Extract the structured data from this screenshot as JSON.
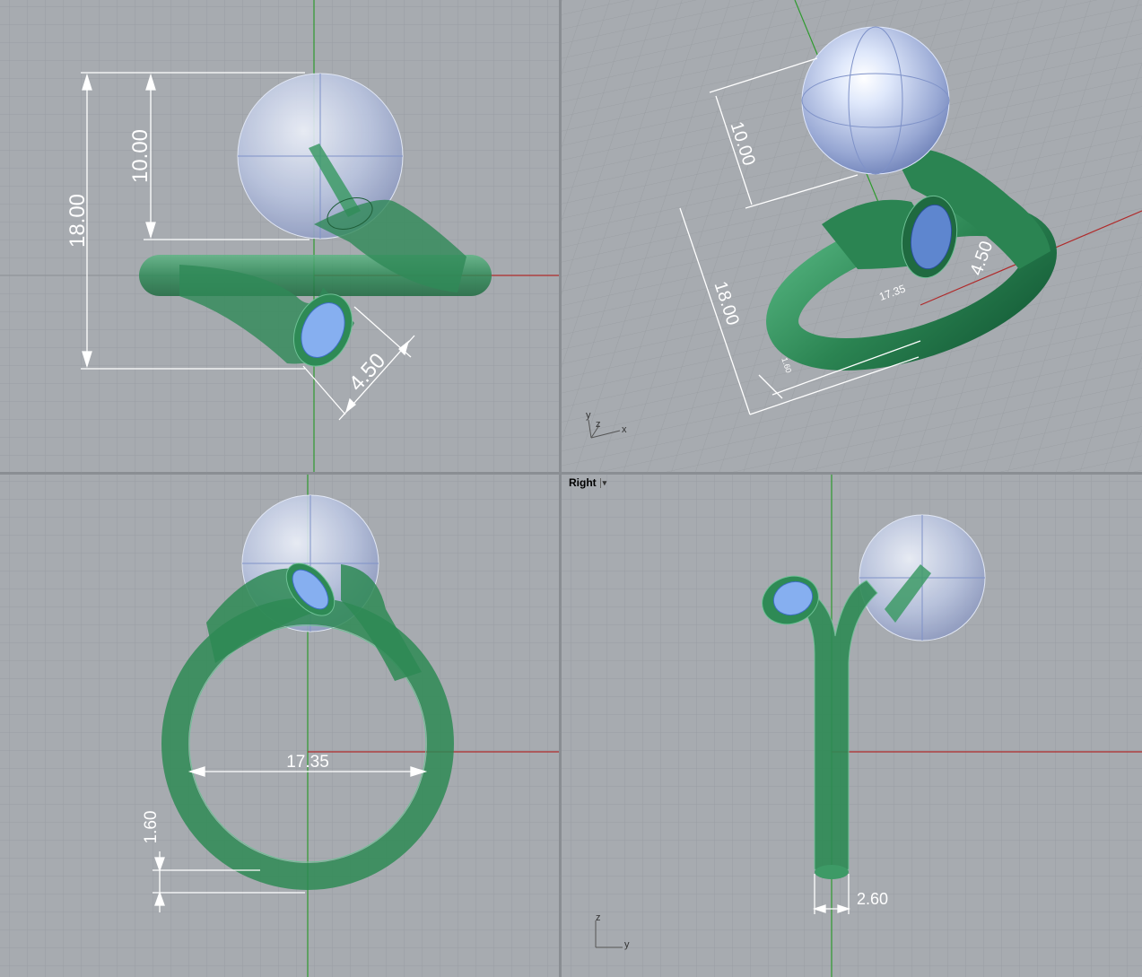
{
  "viewports": {
    "top": {
      "dims": {
        "total_height": "18.00",
        "pearl_height": "10.00",
        "bezel": "4.50"
      }
    },
    "perspective": {
      "dims": {
        "pearl_height": "10.00",
        "total_height": "18.00",
        "bezel": "4.50",
        "inner": "17.35",
        "band": "1.60"
      },
      "axes": {
        "x": "x",
        "y": "y",
        "z": "z"
      }
    },
    "front": {
      "dims": {
        "inner_diameter": "17.35",
        "band_thickness": "1.60"
      }
    },
    "right": {
      "title": "Right",
      "dims": {
        "band_width": "2.60"
      },
      "axes": {
        "z": "z",
        "y": "y"
      }
    }
  },
  "colors": {
    "viewport_bg": "#a7abb0",
    "grid_minor": "#9a9ea3",
    "grid_major": "#8b8f94",
    "x_axis": "#b02a2a",
    "y_axis": "#2e9a2e",
    "metal": "#2e8a55",
    "pearl": "#c9d4ec",
    "gem": "#7aa6e6"
  }
}
